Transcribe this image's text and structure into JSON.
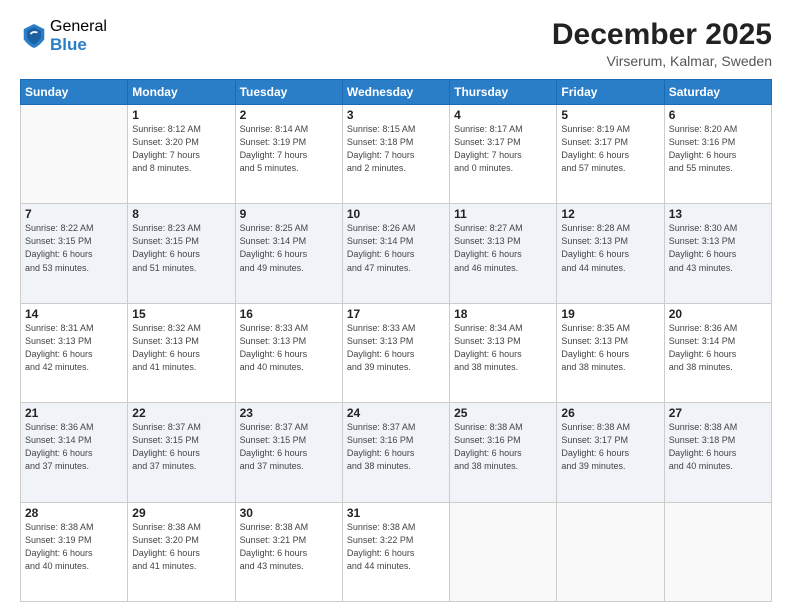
{
  "header": {
    "logo_general": "General",
    "logo_blue": "Blue",
    "month_title": "December 2025",
    "location": "Virserum, Kalmar, Sweden"
  },
  "weekdays": [
    "Sunday",
    "Monday",
    "Tuesday",
    "Wednesday",
    "Thursday",
    "Friday",
    "Saturday"
  ],
  "weeks": [
    [
      {
        "day": "",
        "info": ""
      },
      {
        "day": "1",
        "info": "Sunrise: 8:12 AM\nSunset: 3:20 PM\nDaylight: 7 hours\nand 8 minutes."
      },
      {
        "day": "2",
        "info": "Sunrise: 8:14 AM\nSunset: 3:19 PM\nDaylight: 7 hours\nand 5 minutes."
      },
      {
        "day": "3",
        "info": "Sunrise: 8:15 AM\nSunset: 3:18 PM\nDaylight: 7 hours\nand 2 minutes."
      },
      {
        "day": "4",
        "info": "Sunrise: 8:17 AM\nSunset: 3:17 PM\nDaylight: 7 hours\nand 0 minutes."
      },
      {
        "day": "5",
        "info": "Sunrise: 8:19 AM\nSunset: 3:17 PM\nDaylight: 6 hours\nand 57 minutes."
      },
      {
        "day": "6",
        "info": "Sunrise: 8:20 AM\nSunset: 3:16 PM\nDaylight: 6 hours\nand 55 minutes."
      }
    ],
    [
      {
        "day": "7",
        "info": "Sunrise: 8:22 AM\nSunset: 3:15 PM\nDaylight: 6 hours\nand 53 minutes."
      },
      {
        "day": "8",
        "info": "Sunrise: 8:23 AM\nSunset: 3:15 PM\nDaylight: 6 hours\nand 51 minutes."
      },
      {
        "day": "9",
        "info": "Sunrise: 8:25 AM\nSunset: 3:14 PM\nDaylight: 6 hours\nand 49 minutes."
      },
      {
        "day": "10",
        "info": "Sunrise: 8:26 AM\nSunset: 3:14 PM\nDaylight: 6 hours\nand 47 minutes."
      },
      {
        "day": "11",
        "info": "Sunrise: 8:27 AM\nSunset: 3:13 PM\nDaylight: 6 hours\nand 46 minutes."
      },
      {
        "day": "12",
        "info": "Sunrise: 8:28 AM\nSunset: 3:13 PM\nDaylight: 6 hours\nand 44 minutes."
      },
      {
        "day": "13",
        "info": "Sunrise: 8:30 AM\nSunset: 3:13 PM\nDaylight: 6 hours\nand 43 minutes."
      }
    ],
    [
      {
        "day": "14",
        "info": "Sunrise: 8:31 AM\nSunset: 3:13 PM\nDaylight: 6 hours\nand 42 minutes."
      },
      {
        "day": "15",
        "info": "Sunrise: 8:32 AM\nSunset: 3:13 PM\nDaylight: 6 hours\nand 41 minutes."
      },
      {
        "day": "16",
        "info": "Sunrise: 8:33 AM\nSunset: 3:13 PM\nDaylight: 6 hours\nand 40 minutes."
      },
      {
        "day": "17",
        "info": "Sunrise: 8:33 AM\nSunset: 3:13 PM\nDaylight: 6 hours\nand 39 minutes."
      },
      {
        "day": "18",
        "info": "Sunrise: 8:34 AM\nSunset: 3:13 PM\nDaylight: 6 hours\nand 38 minutes."
      },
      {
        "day": "19",
        "info": "Sunrise: 8:35 AM\nSunset: 3:13 PM\nDaylight: 6 hours\nand 38 minutes."
      },
      {
        "day": "20",
        "info": "Sunrise: 8:36 AM\nSunset: 3:14 PM\nDaylight: 6 hours\nand 38 minutes."
      }
    ],
    [
      {
        "day": "21",
        "info": "Sunrise: 8:36 AM\nSunset: 3:14 PM\nDaylight: 6 hours\nand 37 minutes."
      },
      {
        "day": "22",
        "info": "Sunrise: 8:37 AM\nSunset: 3:15 PM\nDaylight: 6 hours\nand 37 minutes."
      },
      {
        "day": "23",
        "info": "Sunrise: 8:37 AM\nSunset: 3:15 PM\nDaylight: 6 hours\nand 37 minutes."
      },
      {
        "day": "24",
        "info": "Sunrise: 8:37 AM\nSunset: 3:16 PM\nDaylight: 6 hours\nand 38 minutes."
      },
      {
        "day": "25",
        "info": "Sunrise: 8:38 AM\nSunset: 3:16 PM\nDaylight: 6 hours\nand 38 minutes."
      },
      {
        "day": "26",
        "info": "Sunrise: 8:38 AM\nSunset: 3:17 PM\nDaylight: 6 hours\nand 39 minutes."
      },
      {
        "day": "27",
        "info": "Sunrise: 8:38 AM\nSunset: 3:18 PM\nDaylight: 6 hours\nand 40 minutes."
      }
    ],
    [
      {
        "day": "28",
        "info": "Sunrise: 8:38 AM\nSunset: 3:19 PM\nDaylight: 6 hours\nand 40 minutes."
      },
      {
        "day": "29",
        "info": "Sunrise: 8:38 AM\nSunset: 3:20 PM\nDaylight: 6 hours\nand 41 minutes."
      },
      {
        "day": "30",
        "info": "Sunrise: 8:38 AM\nSunset: 3:21 PM\nDaylight: 6 hours\nand 43 minutes."
      },
      {
        "day": "31",
        "info": "Sunrise: 8:38 AM\nSunset: 3:22 PM\nDaylight: 6 hours\nand 44 minutes."
      },
      {
        "day": "",
        "info": ""
      },
      {
        "day": "",
        "info": ""
      },
      {
        "day": "",
        "info": ""
      }
    ]
  ]
}
